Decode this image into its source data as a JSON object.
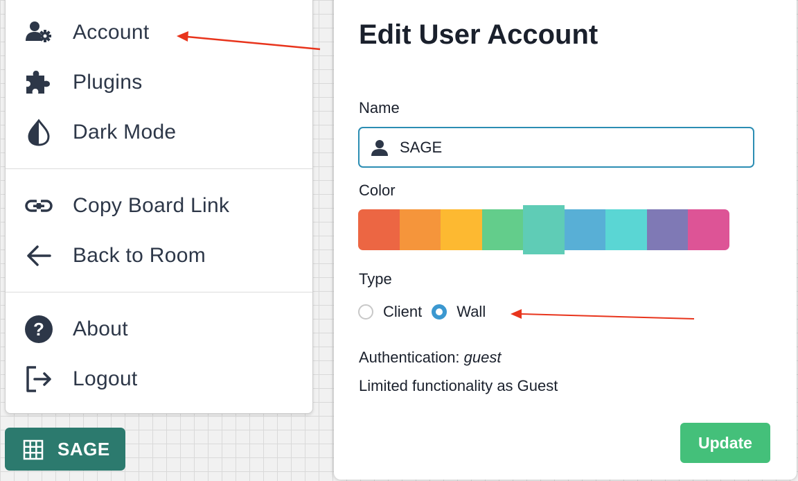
{
  "menu": {
    "items": [
      {
        "label": "Account",
        "icon": "user-gear-icon"
      },
      {
        "label": "Plugins",
        "icon": "puzzle-icon"
      },
      {
        "label": "Dark Mode",
        "icon": "half-drop-icon"
      },
      {
        "label": "Copy Board Link",
        "icon": "link-icon"
      },
      {
        "label": "Back to Room",
        "icon": "arrow-left-icon"
      },
      {
        "label": "About",
        "icon": "question-circle-icon"
      },
      {
        "label": "Logout",
        "icon": "logout-icon"
      }
    ]
  },
  "board_button": {
    "label": "SAGE",
    "icon": "grid-icon",
    "color": "#2c7a6e"
  },
  "modal": {
    "title": "Edit User Account",
    "name_label": "Name",
    "name_value": "SAGE",
    "color_label": "Color",
    "colors": [
      "#ec6643",
      "#f5953b",
      "#fdb931",
      "#63cd8b",
      "#5fccb6",
      "#58afd6",
      "#5ad6d4",
      "#7f79b5",
      "#dd5496"
    ],
    "selected_color_index": 4,
    "type_label": "Type",
    "type_options": [
      "Client",
      "Wall"
    ],
    "type_selected": "Wall",
    "auth_prefix": "Authentication: ",
    "auth_value": "guest",
    "limited_text": "Limited functionality as Guest",
    "update_label": "Update",
    "accent_color": "#3b98d0",
    "update_color": "#44c07a"
  }
}
